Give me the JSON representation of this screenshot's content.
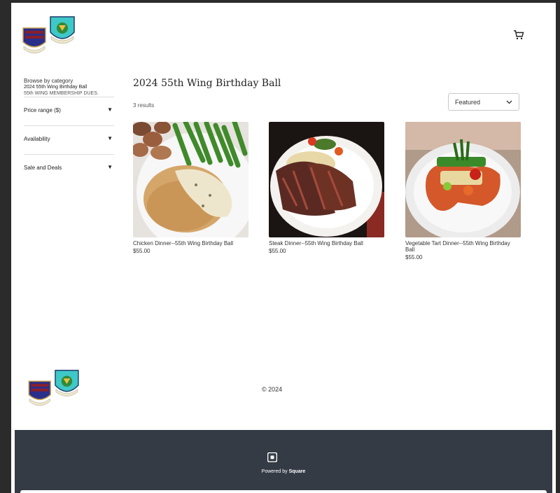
{
  "header": {
    "cart_icon": "cart-icon"
  },
  "sidebar": {
    "browse_label": "Browse by category",
    "categories": [
      "2024 55th Wing Birthday Ball",
      "55th WING MEMBERSHIP DUES."
    ],
    "filters": [
      "Price range ($)",
      "Availability",
      "Sale and Deals"
    ]
  },
  "main": {
    "title": "2024 55th Wing Birthday Ball",
    "results": "3 results",
    "sort_value": "Featured"
  },
  "products": [
    {
      "name": "Chicken Dinner--55th Wing Birthday Ball",
      "price": "$55.00"
    },
    {
      "name": "Steak Dinner--55th Wing Birthday Ball",
      "price": "$55.00"
    },
    {
      "name": "Vegetable Tart Dinner--55th Wing Birthday Ball",
      "price": "$55.00"
    }
  ],
  "footer": {
    "copyright": "© 2024",
    "powered_prefix": "Powered by ",
    "powered_brand": "Square"
  },
  "colors": {
    "footer_bg": "#353b45",
    "page_bg": "#2b2b2b"
  }
}
